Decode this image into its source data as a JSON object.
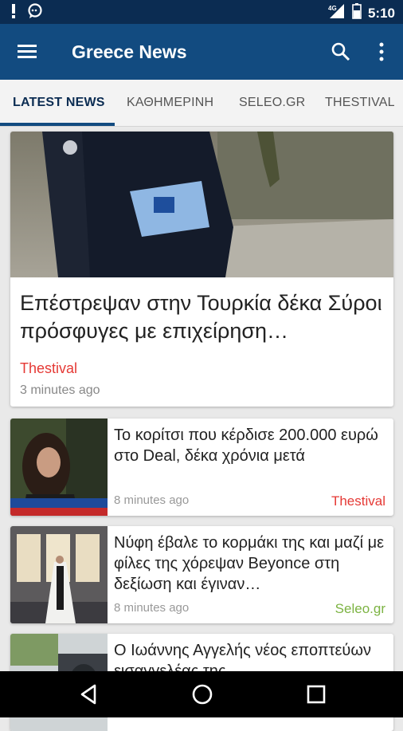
{
  "status_bar": {
    "time": "5:10"
  },
  "app_bar": {
    "title": "Greece News"
  },
  "tabs": [
    {
      "label": "LATEST NEWS",
      "active": true
    },
    {
      "label": "ΚΑΘΗΜΕΡΙΝΗ",
      "active": false
    },
    {
      "label": "SELEO.GR",
      "active": false
    },
    {
      "label": "THESTIVAL",
      "active": false
    }
  ],
  "featured": {
    "headline": "Επέστρεψαν στην Τουρκία δέκα Σύροι πρόσφυγες με επιχείρηση…",
    "source": "Thestival",
    "time": "3 minutes ago",
    "source_color": "#e53935"
  },
  "articles": [
    {
      "headline": "Το κορίτσι που κέρδισε 200.000 ευρώ στο Deal, δέκα χρόνια μετά",
      "time": "8 minutes ago",
      "source": "Thestival",
      "source_color": "#e53935"
    },
    {
      "headline": "Νύφη έβαλε το κορμάκι της και μαζί με φίλες της χόρεψαν Beyonce στη δεξίωση και έγιναν…",
      "time": "8 minutes ago",
      "source": "Seleo.gr",
      "source_color": "#7cb342"
    },
    {
      "headline": "Ο Ιωάννης Αγγελής νέος εποπτεύων εισαγγελέας της",
      "time": "",
      "source": "",
      "source_color": "#e53935"
    }
  ],
  "colors": {
    "status_bar": "#0b2c52",
    "app_bar": "#124b80",
    "background": "#e9e9e9"
  }
}
